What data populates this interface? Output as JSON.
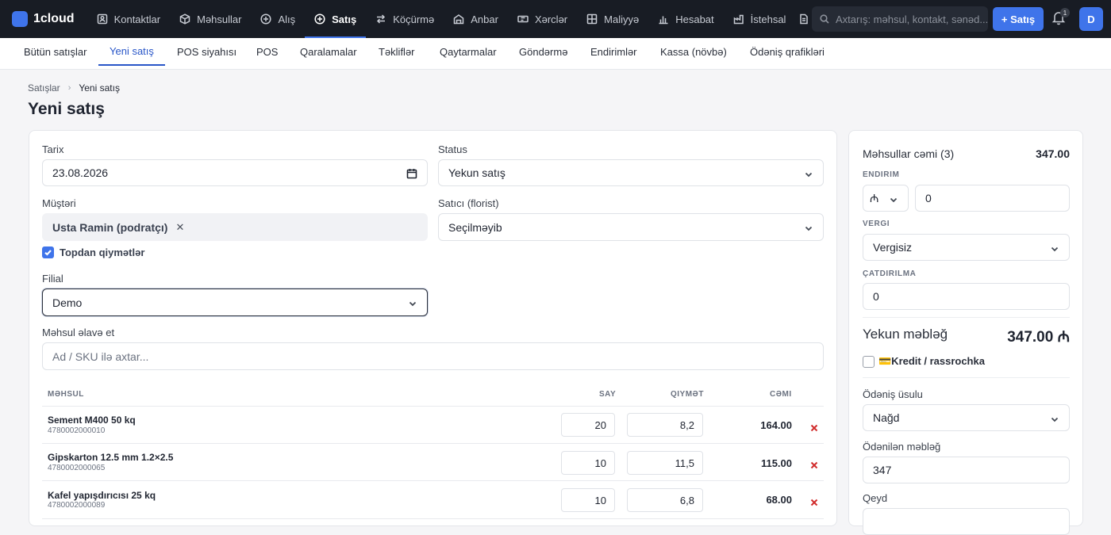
{
  "app": {
    "name": "1cloud"
  },
  "topnav": [
    {
      "label": "Kontaktlar",
      "icon": "contacts-icon"
    },
    {
      "label": "Məhsullar",
      "icon": "box-icon"
    },
    {
      "label": "Alış",
      "icon": "plus-circle-icon"
    },
    {
      "label": "Satış",
      "icon": "plus-circle-icon",
      "active": true
    },
    {
      "label": "Köçürmə",
      "icon": "transfer-icon"
    },
    {
      "label": "Anbar",
      "icon": "warehouse-icon"
    },
    {
      "label": "Xərclər",
      "icon": "ticket-icon"
    },
    {
      "label": "Maliyyə",
      "icon": "grid-icon"
    },
    {
      "label": "Hesabat",
      "icon": "bar-chart-icon"
    },
    {
      "label": "İstehsal",
      "icon": "factory-icon"
    }
  ],
  "search": {
    "placeholder": "Axtarış: məhsul, kontakt, sənəd..."
  },
  "new_button": "+ Satış",
  "notifications": {
    "count": "1"
  },
  "user": {
    "initial": "D"
  },
  "subtabs": [
    "Bütün satışlar",
    "Yeni satış",
    "POS siyahısı",
    "POS",
    "Qaralamalar",
    "Təkliflər",
    "Qaytarmalar",
    "Göndərmə",
    "Endirimlər",
    "Kassa (növbə)",
    "Ödəniş qrafikləri"
  ],
  "breadcrumb": {
    "parent": "Satışlar",
    "current": "Yeni satış"
  },
  "page_title": "Yeni satış",
  "form": {
    "date_label": "Tarix",
    "date_value": "23.08.2026",
    "status_label": "Status",
    "status_value": "Yekun satış",
    "customer_label": "Müştəri",
    "customer_value": "Usta Ramin (podratçı)",
    "seller_label": "Satıcı (florist)",
    "seller_value": "Seçilməyib",
    "wholesale_label": "Topdan qiymətlər",
    "wholesale_checked": true,
    "branch_label": "Filial",
    "branch_value": "Demo",
    "add_product_label": "Məhsul əlavə et",
    "add_product_placeholder": "Ad / SKU ilə axtar..."
  },
  "table": {
    "headers": {
      "product": "Məhsul",
      "qty": "Say",
      "price": "Qiymət",
      "total": "Cəmi"
    },
    "rows": [
      {
        "name": "Sement M400 50 kq",
        "sku": "4780002000010",
        "qty": "20",
        "price": "8,2",
        "total": "164.00"
      },
      {
        "name": "Gipskarton 12.5 mm 1.2×2.5",
        "sku": "4780002000065",
        "qty": "10",
        "price": "11,5",
        "total": "115.00"
      },
      {
        "name": "Kafel yapışdırıcısı 25 kq",
        "sku": "4780002000089",
        "qty": "10",
        "price": "6,8",
        "total": "68.00"
      }
    ]
  },
  "summary": {
    "products_total_label": "Məhsullar cəmi (3)",
    "products_total_value": "347.00",
    "discount_label": "Endirim",
    "discount_type": "₼",
    "discount_value": "0",
    "tax_label": "Vergi",
    "tax_value": "Vergisiz",
    "delivery_label": "Çatdırılma",
    "delivery_value": "0",
    "grand_label": "Yekun məbləğ",
    "grand_value": "347.00 ₼",
    "credit_label": "💳Kredit / rassrochka",
    "credit_checked": false,
    "payment_method_label": "Ödəniş üsulu",
    "payment_method_value": "Nağd",
    "paid_label": "Ödənilən məbləğ",
    "paid_value": "347",
    "note_label": "Qeyd"
  },
  "colors": {
    "accent": "#3f74ea",
    "topbar": "#181c24",
    "delete": "#d12c2c"
  }
}
